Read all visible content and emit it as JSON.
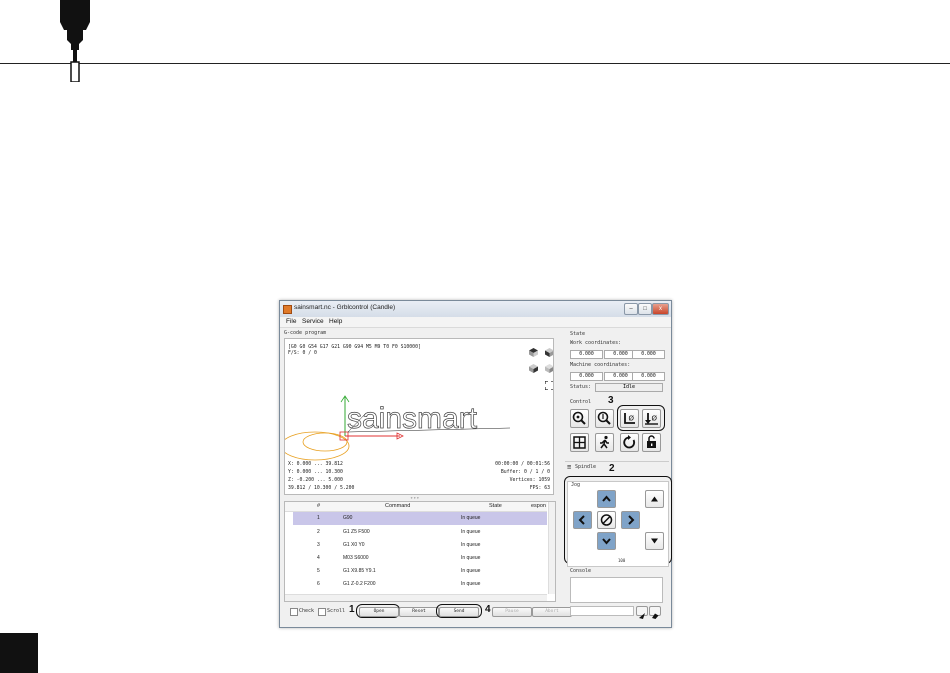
{
  "window": {
    "title": "sainsmart.nc - Grblcontrol (Candle)",
    "controls": {
      "minimize": "–",
      "maximize": "□",
      "close": "x"
    }
  },
  "menu": {
    "items": [
      "File",
      "Service",
      "Help"
    ]
  },
  "gcode_program": {
    "title": "G-code program",
    "overlay_top": [
      "[G0 G0 G54 G17 G21 G90 G94 M5 M9 T0 F0 S10000]",
      "F/S: 0 / 0"
    ],
    "overlay_bottom_left": [
      "X: 0.000 ... 39.812",
      "Y: 0.000 ... 10.300",
      "Z: -0.200 ... 5.000",
      "39.812 / 10.300 / 5.200"
    ],
    "overlay_bottom_right": [
      "00:00:00 / 00:01:56",
      "Buffer: 0 / 1 / 0",
      "Vertices: 1059",
      "FPS: 63"
    ],
    "preview_text": "sainsmart"
  },
  "table": {
    "headers": [
      "#",
      "Command",
      "State",
      "espon"
    ],
    "rows": [
      {
        "num": "1",
        "command": "G90",
        "state": "In queue"
      },
      {
        "num": "2",
        "command": "G1 Z5 F500",
        "state": "In queue"
      },
      {
        "num": "3",
        "command": "G1 X0 Y0",
        "state": "In queue"
      },
      {
        "num": "4",
        "command": "M03 S6000",
        "state": "In queue"
      },
      {
        "num": "5",
        "command": "G1 X9.85 Y9.1",
        "state": "In queue"
      },
      {
        "num": "6",
        "command": "G1 Z-0.2 F200",
        "state": "In queue"
      }
    ]
  },
  "bottom_controls": {
    "check_label": "Check",
    "scroll_label": "Scroll",
    "buttons": {
      "open": "Open",
      "reset": "Reset",
      "send": "Send",
      "pause": "Pause",
      "abort": "Abort"
    }
  },
  "state": {
    "title": "State",
    "work_label": "Work coordinates:",
    "work": [
      "0.000",
      "0.000",
      "0.000"
    ],
    "machine_label": "Machine coordinates:",
    "machine": [
      "0.000",
      "0.000",
      "0.000"
    ],
    "status_label": "Status:",
    "status_value": "Idle"
  },
  "control": {
    "title": "Control"
  },
  "spindle": {
    "title": "Spindle",
    "menu_glyph": "≡"
  },
  "jog": {
    "title": "Jog",
    "step_text": "100"
  },
  "console": {
    "title": "Console"
  },
  "callouts": {
    "one": "1",
    "two": "2",
    "three": "3",
    "four": "4"
  },
  "colors": {
    "accent_blue": "#7fa3c8",
    "selected_row": "#c9c6e9",
    "toolpath_red": "#e03030",
    "origin_orange": "#e8a020"
  }
}
